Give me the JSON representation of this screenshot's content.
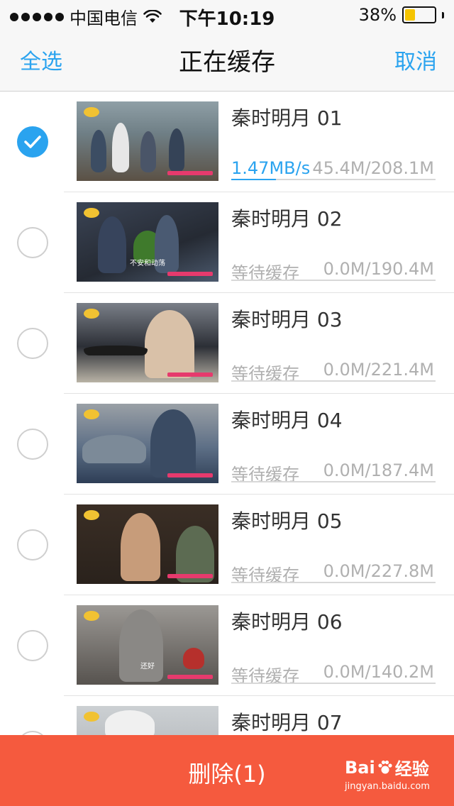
{
  "status_bar": {
    "carrier": "中国电信",
    "time": "下午10:19",
    "battery_percent": "38%",
    "battery_level": 0.38,
    "battery_color": "#f5c400"
  },
  "nav": {
    "select_all": "全选",
    "title": "正在缓存",
    "cancel": "取消"
  },
  "accent_color": "#2aa3ef",
  "episodes": [
    {
      "title": "秦时明月 01",
      "status": "1.47MB/s",
      "size": "45.4M/208.1M",
      "checked": true,
      "progress": 0.22,
      "caption": ""
    },
    {
      "title": "秦时明月 02",
      "status": "等待缓存",
      "size": "0.0M/190.4M",
      "checked": false,
      "progress": 0,
      "caption": "不安和动荡"
    },
    {
      "title": "秦时明月 03",
      "status": "等待缓存",
      "size": "0.0M/221.4M",
      "checked": false,
      "progress": 0,
      "caption": ""
    },
    {
      "title": "秦时明月 04",
      "status": "等待缓存",
      "size": "0.0M/187.4M",
      "checked": false,
      "progress": 0,
      "caption": ""
    },
    {
      "title": "秦时明月 05",
      "status": "等待缓存",
      "size": "0.0M/227.8M",
      "checked": false,
      "progress": 0,
      "caption": ""
    },
    {
      "title": "秦时明月 06",
      "status": "等待缓存",
      "size": "0.0M/140.2M",
      "checked": false,
      "progress": 0,
      "caption": "还好"
    },
    {
      "title": "秦时明月 07",
      "status": "",
      "size": "",
      "checked": false,
      "progress": 0,
      "caption": ""
    }
  ],
  "bottom_bar": {
    "delete_label": "删除(1)",
    "bg_color": "#f55a3e"
  },
  "watermark": {
    "brand": "Bai经验",
    "url": "jingyan.baidu.com"
  }
}
